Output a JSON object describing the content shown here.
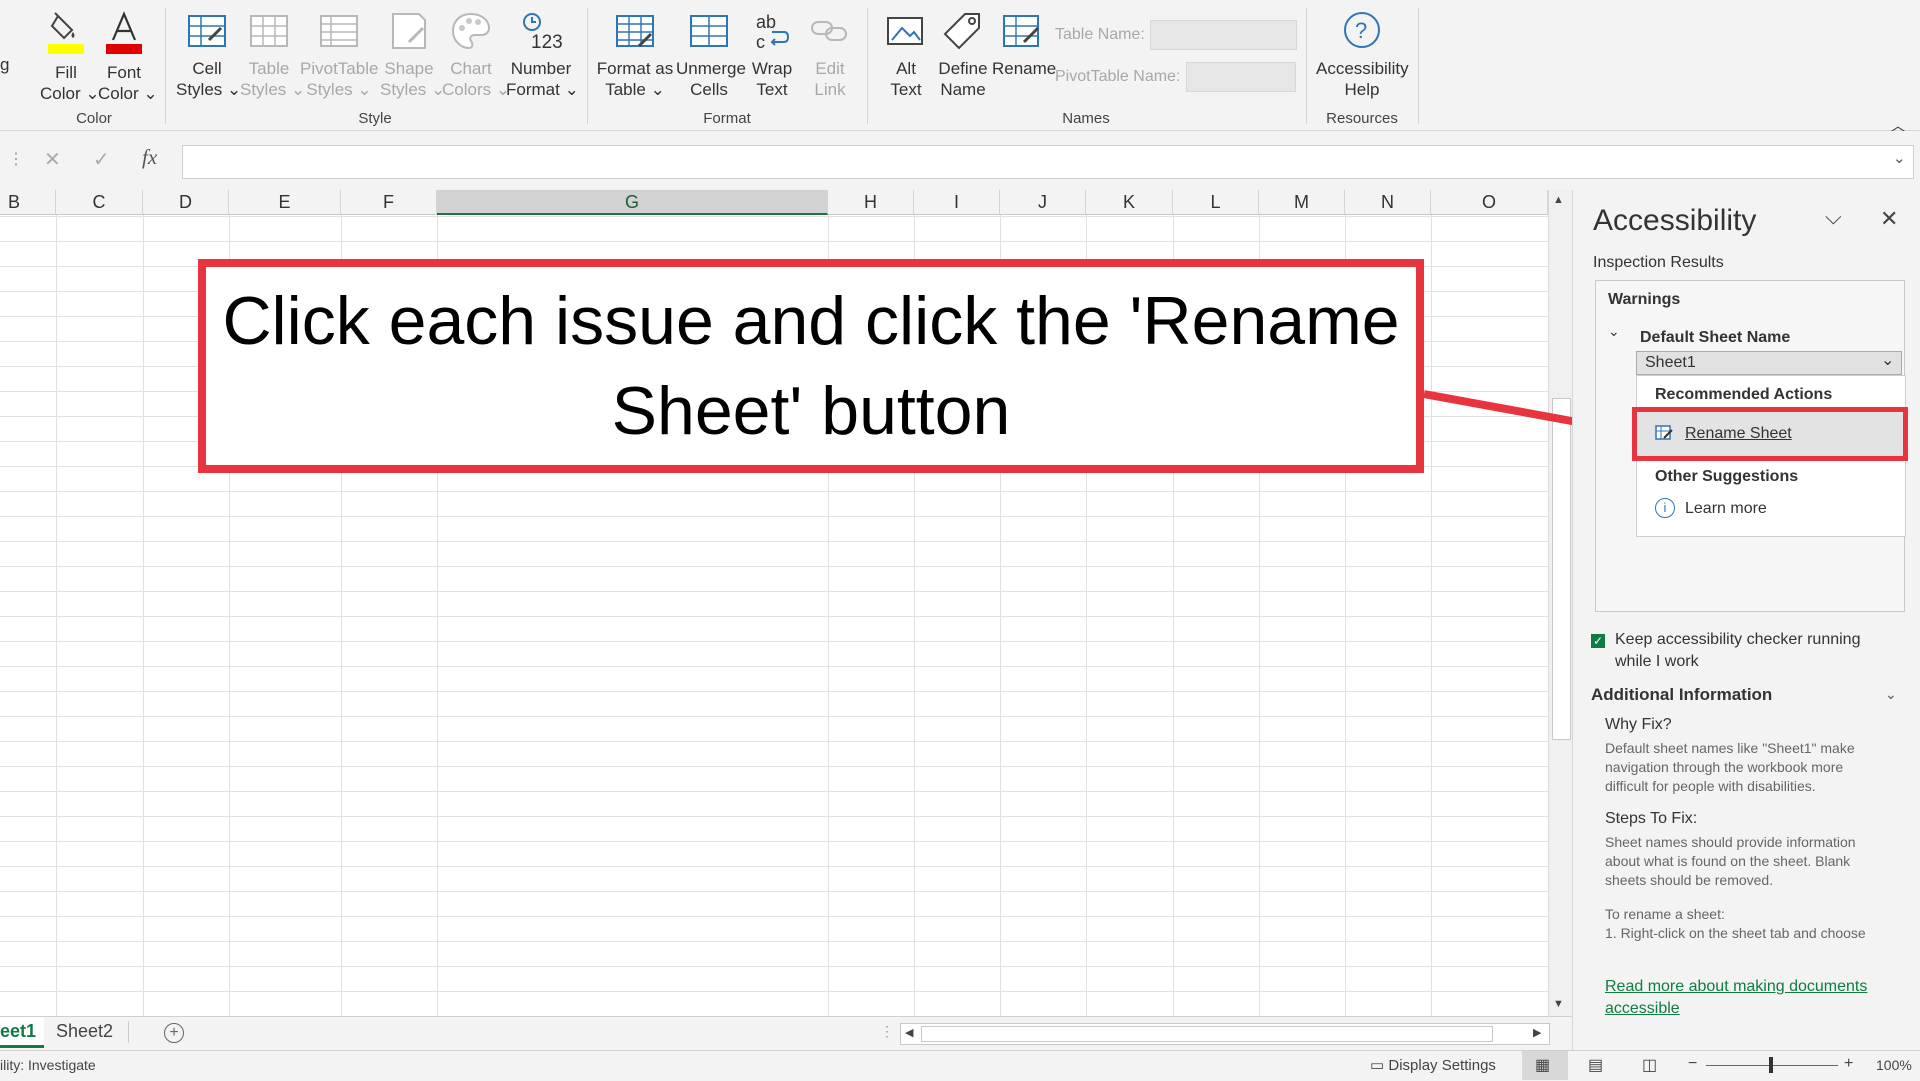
{
  "ribbon": {
    "partial_label": "g",
    "color_group": {
      "label": "Color",
      "fill_color": [
        "Fill",
        "Color"
      ],
      "font_color": [
        "Font",
        "Color"
      ]
    },
    "style_group": {
      "label": "Style",
      "cell_styles": [
        "Cell",
        "Styles"
      ],
      "table_styles": [
        "Table",
        "Styles"
      ],
      "pivottable_styles": [
        "PivotTable",
        "Styles"
      ],
      "shape_styles": [
        "Shape",
        "Styles"
      ],
      "chart_colors": [
        "Chart",
        "Colors"
      ],
      "number_format": [
        "Number",
        "Format"
      ]
    },
    "format_group": {
      "label": "Format",
      "format_as_table": [
        "Format as",
        "Table"
      ],
      "unmerge_cells": [
        "Unmerge",
        "Cells"
      ],
      "wrap_text": [
        "Wrap",
        "Text"
      ],
      "edit_link": [
        "Edit",
        "Link"
      ]
    },
    "names_group": {
      "label": "Names",
      "alt_text": [
        "Alt",
        "Text"
      ],
      "define_name": [
        "Define",
        "Name"
      ],
      "rename": "Rename",
      "table_name_label": "Table Name:",
      "pivottable_name_label": "PivotTable Name:"
    },
    "resources_group": {
      "label": "Resources",
      "accessibility_help": [
        "Accessibility",
        "Help"
      ]
    },
    "colors": {
      "fill_yellow": "#ffff00",
      "font_red": "#e00000",
      "accent_blue": "#2e75b6"
    }
  },
  "formula_bar": {
    "fx": "fx",
    "value": ""
  },
  "columns": [
    "B",
    "C",
    "D",
    "E",
    "F",
    "G",
    "H",
    "I",
    "J",
    "K",
    "L",
    "M",
    "N",
    "O"
  ],
  "selected_column": "G",
  "callout": {
    "text": "Click each issue and click the 'Rename Sheet' button",
    "border_color": "#e8343f"
  },
  "panel": {
    "title": "Accessibility",
    "inspection_results": "Inspection Results",
    "warnings": "Warnings",
    "default_sheet_name": "Default Sheet Name",
    "sheet_item": "Sheet1",
    "recommended_actions": "Recommended Actions",
    "rename_sheet": "Rename Sheet",
    "other_suggestions": "Other Suggestions",
    "learn_more": "Learn more",
    "keep_running_line1": "Keep accessibility checker running",
    "keep_running_line2": "while I work",
    "keep_running_checked": true,
    "additional_information": "Additional Information",
    "why_fix": "Why Fix?",
    "why_fix_lines": [
      "Default sheet names like \"Sheet1\" make",
      "navigation through the workbook more",
      "difficult for people with disabilities."
    ],
    "steps_to_fix": "Steps To Fix:",
    "steps_lines": [
      "Sheet names should provide information",
      "about what is found on the sheet. Blank",
      "sheets should be removed."
    ],
    "rename_steps_lines": [
      "To rename a sheet:",
      "1. Right-click on the sheet tab and choose"
    ],
    "read_more_lines": [
      "Read more about making documents",
      "accessible"
    ],
    "link_color": "#107c41",
    "highlight_color": "#e8343f"
  },
  "sheet_tabs": {
    "active": "eet1",
    "other": "Sheet2"
  },
  "status_bar": {
    "left_text": "ility: Investigate",
    "display_settings": "Display Settings",
    "zoom": "100%",
    "zoom_minus": "−",
    "zoom_plus": "+"
  }
}
